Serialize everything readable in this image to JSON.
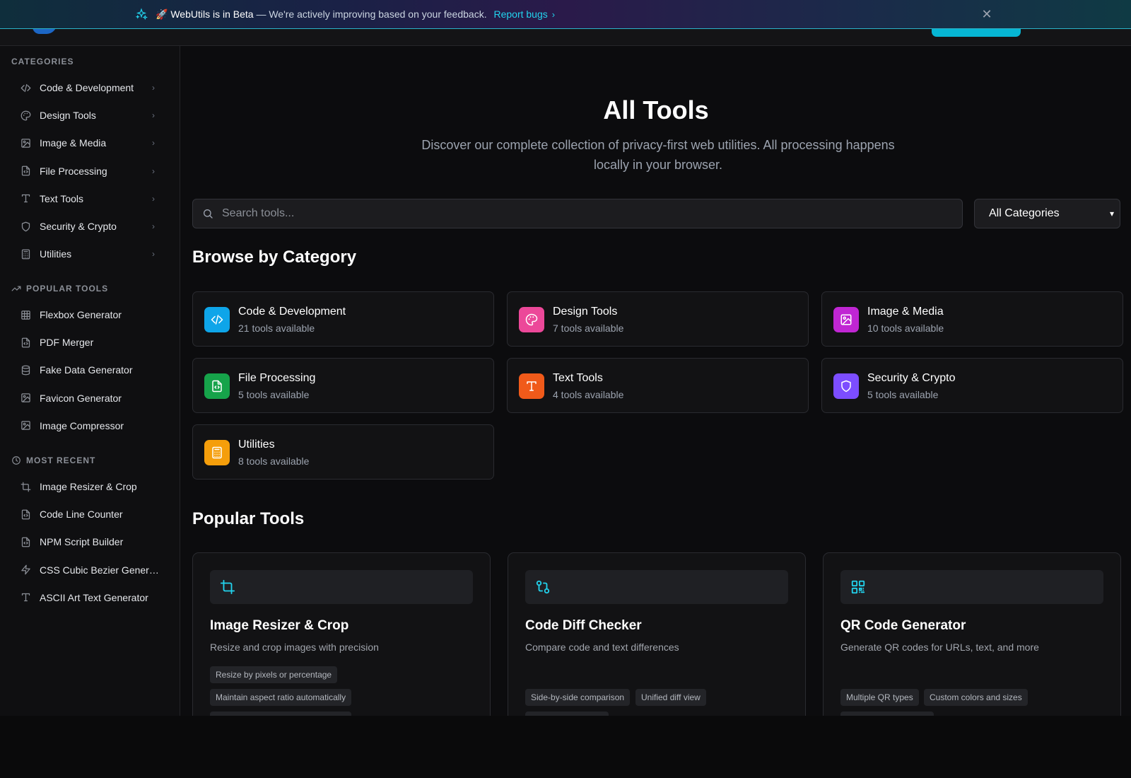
{
  "banner": {
    "emoji": "🚀",
    "title": "WebUtils is in Beta",
    "message": " — We're actively improving based on your feedback.",
    "link": "Report bugs",
    "close": "✕"
  },
  "sidebar": {
    "categories_label": "CATEGORIES",
    "categories": [
      {
        "label": "Code & Development",
        "icon": "code-icon"
      },
      {
        "label": "Design Tools",
        "icon": "palette-icon"
      },
      {
        "label": "Image & Media",
        "icon": "image-icon"
      },
      {
        "label": "File Processing",
        "icon": "file-code-icon"
      },
      {
        "label": "Text Tools",
        "icon": "type-icon"
      },
      {
        "label": "Security & Crypto",
        "icon": "shield-icon"
      },
      {
        "label": "Utilities",
        "icon": "calculator-icon"
      }
    ],
    "popular_label": "POPULAR TOOLS",
    "popular": [
      {
        "label": "Flexbox Generator",
        "icon": "grid-icon"
      },
      {
        "label": "PDF Merger",
        "icon": "file-code-icon"
      },
      {
        "label": "Fake Data Generator",
        "icon": "database-icon"
      },
      {
        "label": "Favicon Generator",
        "icon": "image-icon"
      },
      {
        "label": "Image Compressor",
        "icon": "image-icon"
      }
    ],
    "recent_label": "MOST RECENT",
    "recent": [
      {
        "label": "Image Resizer & Crop",
        "icon": "crop-icon"
      },
      {
        "label": "Code Line Counter",
        "icon": "file-code-icon"
      },
      {
        "label": "NPM Script Builder",
        "icon": "file-code-icon"
      },
      {
        "label": "CSS Cubic Bezier Gener…",
        "icon": "zap-icon"
      },
      {
        "label": "ASCII Art Text Generator",
        "icon": "type-icon"
      }
    ]
  },
  "main": {
    "title": "All Tools",
    "subtitle": "Discover our complete collection of privacy-first web utilities. All processing happens locally in your browser.",
    "search_placeholder": "Search tools...",
    "category_select": "All Categories",
    "browse_heading": "Browse by Category",
    "categories": [
      {
        "name": "Code & Development",
        "count": "21 tools available",
        "color": "#0ea5e9",
        "icon": "code-icon"
      },
      {
        "name": "Design Tools",
        "count": "7 tools available",
        "color": "#ec4899",
        "icon": "palette-icon"
      },
      {
        "name": "Image & Media",
        "count": "10 tools available",
        "color": "#c026d3",
        "icon": "image-icon"
      },
      {
        "name": "File Processing",
        "count": "5 tools available",
        "color": "#16a34a",
        "icon": "file-code-icon"
      },
      {
        "name": "Text Tools",
        "count": "4 tools available",
        "color": "#f05a1a",
        "icon": "type-icon"
      },
      {
        "name": "Security & Crypto",
        "count": "5 tools available",
        "color": "#7c4dff",
        "icon": "shield-icon"
      },
      {
        "name": "Utilities",
        "count": "8 tools available",
        "color": "#f59e0b",
        "icon": "calculator-icon"
      }
    ],
    "popular_heading": "Popular Tools",
    "popular_tools": [
      {
        "name": "Image Resizer & Crop",
        "desc": "Resize and crop images with precision",
        "icon": "crop-icon",
        "tags": [
          "Resize by pixels or percentage",
          "Maintain aspect ratio automatically"
        ]
      },
      {
        "name": "Code Diff Checker",
        "desc": "Compare code and text differences",
        "icon": "git-compare-icon",
        "tags": [
          "Side-by-side comparison",
          "Unified diff view"
        ]
      },
      {
        "name": "QR Code Generator",
        "desc": "Generate QR codes for URLs, text, and more",
        "icon": "qr-code-icon",
        "tags": [
          "Multiple QR types",
          "Custom colors and sizes"
        ]
      }
    ]
  },
  "colors": {
    "accent": "#22d3ee",
    "background": "#0c0c0e"
  }
}
